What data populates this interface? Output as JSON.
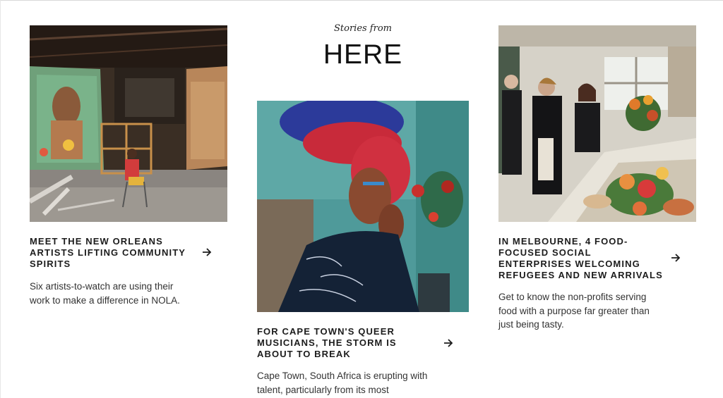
{
  "section": {
    "kicker": "Stories from",
    "title": "HERE"
  },
  "stories": [
    {
      "headline_lines": [
        "MEET THE NEW ORLEANS",
        "ARTISTS LIFTING COMMUNITY",
        "SPIRITS"
      ],
      "summary_lines": [
        "Six artists-to-watch are using their",
        "work to make a difference in NOLA."
      ],
      "image_subject": "artist seated in a warehouse studio with large murals",
      "arrow_icon": "arrow-right-icon"
    },
    {
      "headline_lines": [
        "FOR CAPE TOWN'S QUEER",
        "MUSICIANS, THE STORM IS",
        "ABOUT TO BREAK"
      ],
      "summary_lines": [
        "Cape Town, South Africa is erupting with",
        "talent, particularly from its most"
      ],
      "image_subject": "portrait of a musician in a red and blue headwrap",
      "arrow_icon": "arrow-right-icon"
    },
    {
      "headline_lines": [
        "IN MELBOURNE, 4 FOOD-",
        "FOCUSED SOCIAL",
        "ENTERPRISES WELCOMING",
        "REFUGEES AND NEW ARRIVALS"
      ],
      "summary_lines": [
        "Get to know the non-profits serving",
        "food with a purpose far greater than",
        "just being tasty."
      ],
      "image_subject": "people preparing a flower-decorated food table in a restaurant",
      "arrow_icon": "arrow-right-icon"
    }
  ],
  "colors": {
    "text": "#1c1c1c",
    "body_text": "#333333",
    "background": "#ffffff"
  }
}
